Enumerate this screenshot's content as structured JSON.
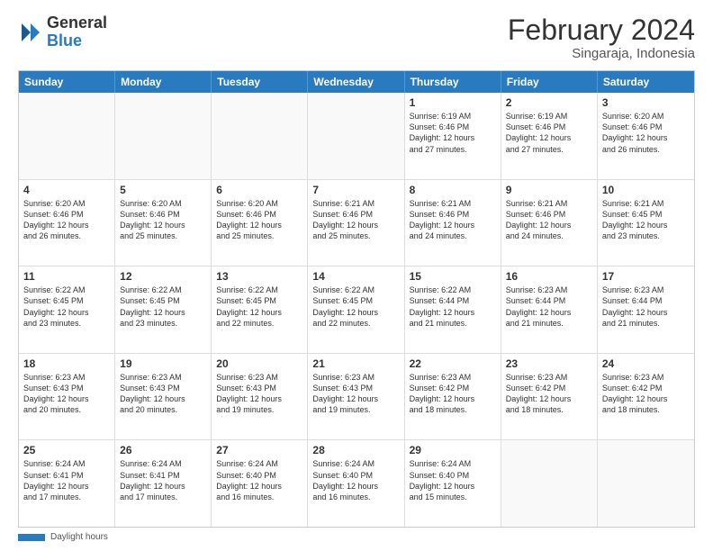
{
  "logo": {
    "general": "General",
    "blue": "Blue"
  },
  "header": {
    "month_year": "February 2024",
    "location": "Singaraja, Indonesia"
  },
  "calendar": {
    "days_of_week": [
      "Sunday",
      "Monday",
      "Tuesday",
      "Wednesday",
      "Thursday",
      "Friday",
      "Saturday"
    ],
    "footer_note": "Daylight hours"
  },
  "weeks": [
    {
      "cells": [
        {
          "day": "",
          "info": ""
        },
        {
          "day": "",
          "info": ""
        },
        {
          "day": "",
          "info": ""
        },
        {
          "day": "",
          "info": ""
        },
        {
          "day": "1",
          "info": "Sunrise: 6:19 AM\nSunset: 6:46 PM\nDaylight: 12 hours\nand 27 minutes."
        },
        {
          "day": "2",
          "info": "Sunrise: 6:19 AM\nSunset: 6:46 PM\nDaylight: 12 hours\nand 27 minutes."
        },
        {
          "day": "3",
          "info": "Sunrise: 6:20 AM\nSunset: 6:46 PM\nDaylight: 12 hours\nand 26 minutes."
        }
      ]
    },
    {
      "cells": [
        {
          "day": "4",
          "info": "Sunrise: 6:20 AM\nSunset: 6:46 PM\nDaylight: 12 hours\nand 26 minutes."
        },
        {
          "day": "5",
          "info": "Sunrise: 6:20 AM\nSunset: 6:46 PM\nDaylight: 12 hours\nand 25 minutes."
        },
        {
          "day": "6",
          "info": "Sunrise: 6:20 AM\nSunset: 6:46 PM\nDaylight: 12 hours\nand 25 minutes."
        },
        {
          "day": "7",
          "info": "Sunrise: 6:21 AM\nSunset: 6:46 PM\nDaylight: 12 hours\nand 25 minutes."
        },
        {
          "day": "8",
          "info": "Sunrise: 6:21 AM\nSunset: 6:46 PM\nDaylight: 12 hours\nand 24 minutes."
        },
        {
          "day": "9",
          "info": "Sunrise: 6:21 AM\nSunset: 6:46 PM\nDaylight: 12 hours\nand 24 minutes."
        },
        {
          "day": "10",
          "info": "Sunrise: 6:21 AM\nSunset: 6:45 PM\nDaylight: 12 hours\nand 23 minutes."
        }
      ]
    },
    {
      "cells": [
        {
          "day": "11",
          "info": "Sunrise: 6:22 AM\nSunset: 6:45 PM\nDaylight: 12 hours\nand 23 minutes."
        },
        {
          "day": "12",
          "info": "Sunrise: 6:22 AM\nSunset: 6:45 PM\nDaylight: 12 hours\nand 23 minutes."
        },
        {
          "day": "13",
          "info": "Sunrise: 6:22 AM\nSunset: 6:45 PM\nDaylight: 12 hours\nand 22 minutes."
        },
        {
          "day": "14",
          "info": "Sunrise: 6:22 AM\nSunset: 6:45 PM\nDaylight: 12 hours\nand 22 minutes."
        },
        {
          "day": "15",
          "info": "Sunrise: 6:22 AM\nSunset: 6:44 PM\nDaylight: 12 hours\nand 21 minutes."
        },
        {
          "day": "16",
          "info": "Sunrise: 6:23 AM\nSunset: 6:44 PM\nDaylight: 12 hours\nand 21 minutes."
        },
        {
          "day": "17",
          "info": "Sunrise: 6:23 AM\nSunset: 6:44 PM\nDaylight: 12 hours\nand 21 minutes."
        }
      ]
    },
    {
      "cells": [
        {
          "day": "18",
          "info": "Sunrise: 6:23 AM\nSunset: 6:43 PM\nDaylight: 12 hours\nand 20 minutes."
        },
        {
          "day": "19",
          "info": "Sunrise: 6:23 AM\nSunset: 6:43 PM\nDaylight: 12 hours\nand 20 minutes."
        },
        {
          "day": "20",
          "info": "Sunrise: 6:23 AM\nSunset: 6:43 PM\nDaylight: 12 hours\nand 19 minutes."
        },
        {
          "day": "21",
          "info": "Sunrise: 6:23 AM\nSunset: 6:43 PM\nDaylight: 12 hours\nand 19 minutes."
        },
        {
          "day": "22",
          "info": "Sunrise: 6:23 AM\nSunset: 6:42 PM\nDaylight: 12 hours\nand 18 minutes."
        },
        {
          "day": "23",
          "info": "Sunrise: 6:23 AM\nSunset: 6:42 PM\nDaylight: 12 hours\nand 18 minutes."
        },
        {
          "day": "24",
          "info": "Sunrise: 6:23 AM\nSunset: 6:42 PM\nDaylight: 12 hours\nand 18 minutes."
        }
      ]
    },
    {
      "cells": [
        {
          "day": "25",
          "info": "Sunrise: 6:24 AM\nSunset: 6:41 PM\nDaylight: 12 hours\nand 17 minutes."
        },
        {
          "day": "26",
          "info": "Sunrise: 6:24 AM\nSunset: 6:41 PM\nDaylight: 12 hours\nand 17 minutes."
        },
        {
          "day": "27",
          "info": "Sunrise: 6:24 AM\nSunset: 6:40 PM\nDaylight: 12 hours\nand 16 minutes."
        },
        {
          "day": "28",
          "info": "Sunrise: 6:24 AM\nSunset: 6:40 PM\nDaylight: 12 hours\nand 16 minutes."
        },
        {
          "day": "29",
          "info": "Sunrise: 6:24 AM\nSunset: 6:40 PM\nDaylight: 12 hours\nand 15 minutes."
        },
        {
          "day": "",
          "info": ""
        },
        {
          "day": "",
          "info": ""
        }
      ]
    }
  ]
}
